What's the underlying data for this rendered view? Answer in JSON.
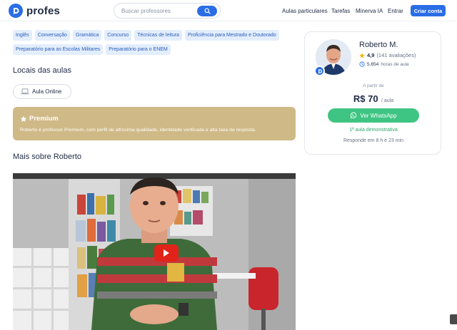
{
  "header": {
    "logo_text": "profes",
    "search_placeholder": "Buscar professores",
    "nav": [
      "Aulas particulares",
      "Tarefas",
      "Minerva IA",
      "Entrar"
    ],
    "cta_label": "Criar conta"
  },
  "tags": [
    "Inglês",
    "Conversação",
    "Gramática",
    "Concurso",
    "Técnicas de leitura",
    "Proficiência para Mestrado e Doutorado",
    "Preparatório para as Escolas Militares",
    "Preparatório para o ENEM"
  ],
  "locations": {
    "title": "Locais das aulas",
    "online_label": "Aula Online"
  },
  "premium": {
    "title": "Premium",
    "text": "Roberto é professor Premium, com perfil de altíssima qualidade, identidade verificada e alta taxa de resposta."
  },
  "more": {
    "title": "Mais sobre Roberto"
  },
  "profile": {
    "name": "Roberto M.",
    "rating": "4,9",
    "reviews": "(141 avaliações)",
    "hours_value": "5.654",
    "hours_label": "horas de aula",
    "from_label": "A partir de",
    "price": "R$ 70",
    "price_unit": "/ aula",
    "whatsapp_label": "Ver WhatsApp",
    "demo_label": "1ª aula demonstrativa",
    "responds_label": "Responde em 8 h e 23 min"
  },
  "colors": {
    "brand": "#2a6de6",
    "premium_bg": "#cfb987",
    "whatsapp": "#3fc583",
    "tag_bg": "#e3eefd",
    "youtube_red": "#e1231a"
  }
}
